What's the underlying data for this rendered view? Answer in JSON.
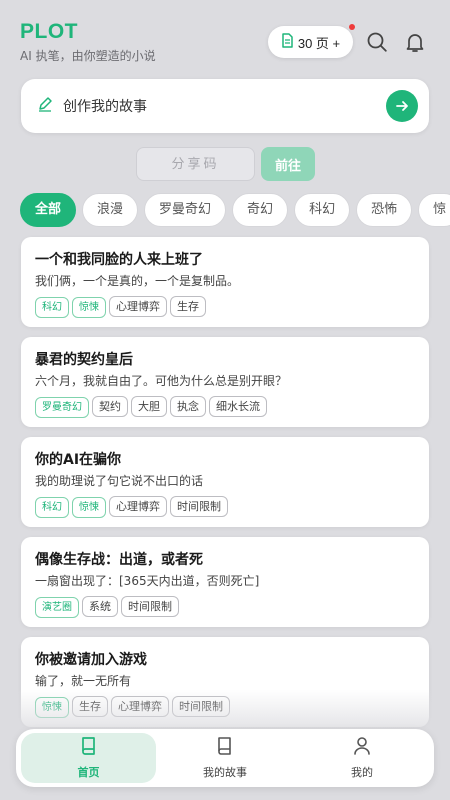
{
  "app": {
    "logo": "PLOT",
    "tagline": "AI 执笔，由你塑造的小说",
    "pages_badge": "30 页 +"
  },
  "create": {
    "label": "创作我的故事"
  },
  "share": {
    "placeholder": "分享码",
    "go_label": "前往"
  },
  "categories": [
    "全部",
    "浪漫",
    "罗曼奇幻",
    "奇幻",
    "科幻",
    "恐怖",
    "惊"
  ],
  "stories": [
    {
      "title": "一个和我同脸的人来上班了",
      "desc": "我们俩，一个是真的，一个是复制品。",
      "tags": [
        "科幻",
        "惊悚",
        "心理博弈",
        "生存"
      ]
    },
    {
      "title": "暴君的契约皇后",
      "desc": "六个月，我就自由了。可他为什么总是别开眼？",
      "tags": [
        "罗曼奇幻",
        "契约",
        "大胆",
        "执念",
        "细水长流"
      ]
    },
    {
      "title": "你的AI在骗你",
      "desc": "我的助理说了句它说不出口的话",
      "tags": [
        "科幻",
        "惊悚",
        "心理博弈",
        "时间限制"
      ]
    },
    {
      "title": "偶像生存战：出道，或者死",
      "desc": "一扇窗出现了：[365天内出道，否则死亡]",
      "tags": [
        "演艺圈",
        "系统",
        "时间限制"
      ]
    },
    {
      "title": "你被邀请加入游戏",
      "desc": "输了，就一无所有",
      "tags": [
        "惊悚",
        "生存",
        "心理博弈",
        "时间限制"
      ]
    }
  ],
  "green_tags": [
    "科幻",
    "惊悚",
    "罗曼奇幻",
    "演艺圈"
  ],
  "nav": [
    {
      "label": "首页",
      "icon": "book-icon",
      "active": true
    },
    {
      "label": "我的故事",
      "icon": "book-outline-icon",
      "active": false
    },
    {
      "label": "我的",
      "icon": "user-icon",
      "active": false
    }
  ],
  "colors": {
    "accent": "#1fb57a",
    "background": "#dcdce0",
    "notification": "#ee3b3b"
  }
}
